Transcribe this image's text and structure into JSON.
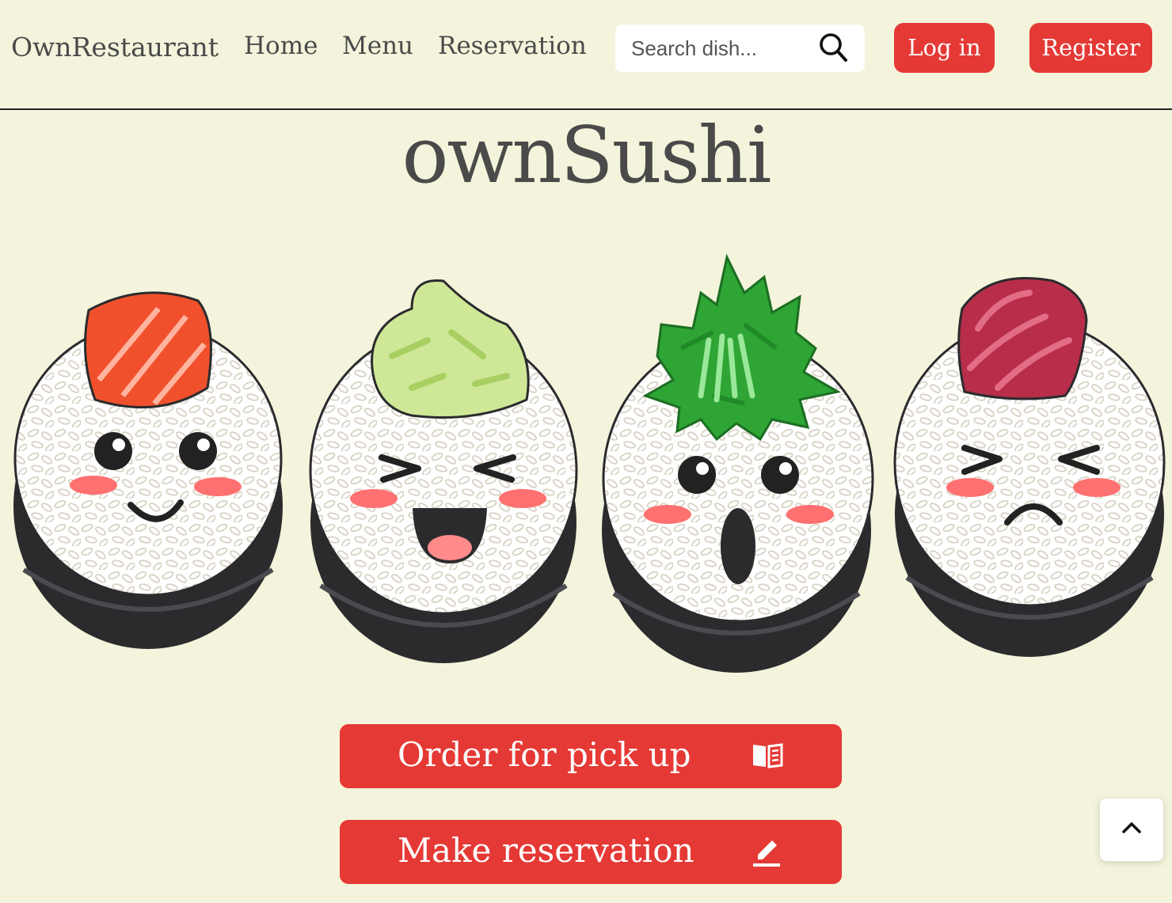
{
  "header": {
    "brand": "OwnRestaurant",
    "nav": [
      {
        "label": "Home"
      },
      {
        "label": "Menu"
      },
      {
        "label": "Reservation"
      }
    ],
    "search": {
      "placeholder": "Search dish...",
      "value": "",
      "icon": "search-icon"
    },
    "login_label": "Log in",
    "register_label": "Register"
  },
  "hero": {
    "title": "ownSushi",
    "illustration": "four cartoon sushi rolls with salmon, wasabi, seaweed and tuna toppings"
  },
  "actions": [
    {
      "label": "Order for pick up",
      "icon": "book-icon"
    },
    {
      "label": "Make reservation",
      "icon": "pencil-icon"
    }
  ],
  "scroll_top": {
    "icon": "chevron-up-icon"
  },
  "colors": {
    "background": "#f4f4dc",
    "accent": "#e53935",
    "text": "#4a4a4a",
    "nori": "#2b2b2e",
    "rice": "#ffffff",
    "blush": "#ff7070"
  }
}
